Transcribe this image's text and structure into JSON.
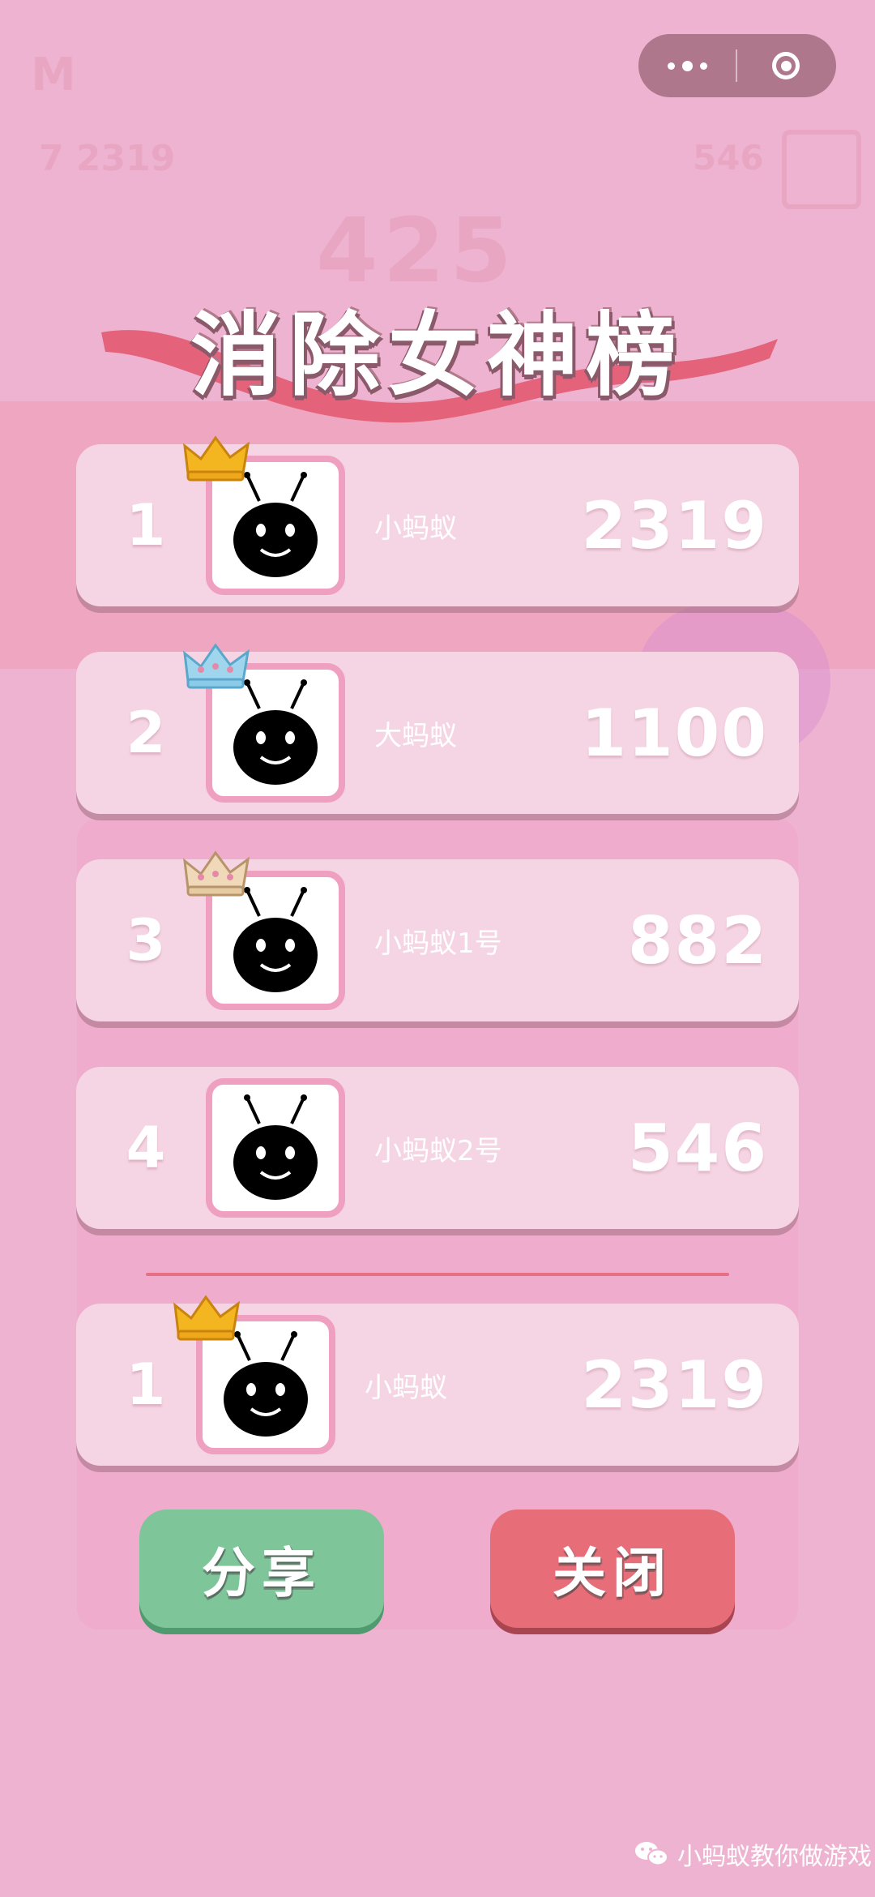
{
  "title": "消除女神榜",
  "background_ghost": {
    "left_top": "M",
    "left_score": "7 2319",
    "right_score": "546",
    "center_score": "425"
  },
  "leaderboard": [
    {
      "rank": "1",
      "name": "小蚂蚁",
      "score": "2319",
      "crown": "gold"
    },
    {
      "rank": "2",
      "name": "大蚂蚁",
      "score": "1100",
      "crown": "blue"
    },
    {
      "rank": "3",
      "name": "小蚂蚁1号",
      "score": "882",
      "crown": "bronze"
    },
    {
      "rank": "4",
      "name": "小蚂蚁2号",
      "score": "546",
      "crown": ""
    }
  ],
  "my_rank": {
    "rank": "1",
    "name": "小蚂蚁",
    "score": "2319",
    "crown": "gold"
  },
  "buttons": {
    "share": "分享",
    "close": "关闭"
  },
  "watermark": "小蚂蚁教你做游戏",
  "colors": {
    "background": "#efb3d2",
    "card": "#f5d4e3",
    "avatar_border": "#ef9fc0",
    "share_button": "#7fc59a",
    "close_button": "#e76d79",
    "divider": "#e76f83"
  }
}
